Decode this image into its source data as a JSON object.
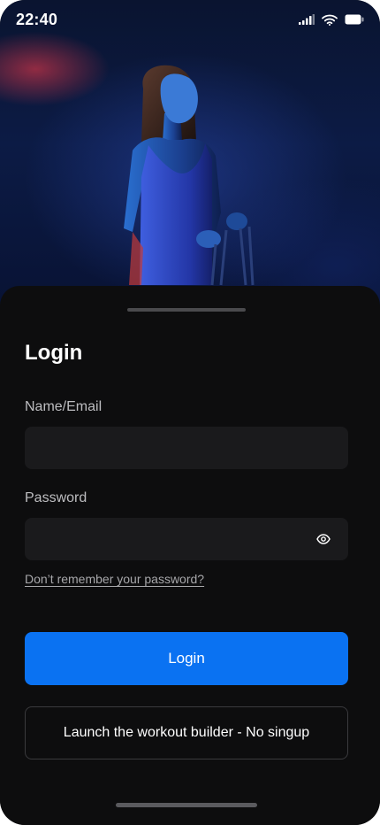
{
  "status_bar": {
    "time": "22:40",
    "icons": [
      "cellular-signal-icon",
      "wifi-icon",
      "battery-icon"
    ]
  },
  "hero": {
    "image": "woman-with-jump-rope-photo"
  },
  "login": {
    "title": "Login",
    "name_label": "Name/Email",
    "name_value": "",
    "password_label": "Password",
    "password_value": "",
    "password_toggle_icon": "eye-icon",
    "forgot_link": "Don’t remember your password?",
    "login_button": "Login",
    "builder_button": "Launch the workout builder - No singup"
  },
  "colors": {
    "sheet_background": "#0d0d0e",
    "field_background": "#1a1a1c",
    "primary": "#0a72f2",
    "text": "#ffffff",
    "muted_text": "#bdbdc0"
  }
}
